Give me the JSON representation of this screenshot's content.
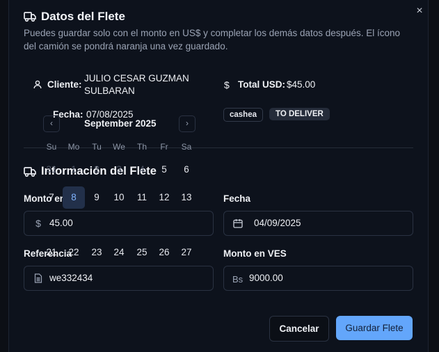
{
  "modal": {
    "title": "Datos del Flete",
    "description": "Puedes guardar solo con el monto en US$ y completar los demás datos después. El ícono del camión se pondrá naranja una vez guardado.",
    "close_icon": "×"
  },
  "summary": {
    "cliente_label": "Cliente:",
    "cliente_line1": "JULIO CESAR GUZMAN",
    "cliente_line2": "SULBARAN",
    "total_label": "Total USD:",
    "total_value": "$45.00",
    "fecha_label": "Fecha:",
    "fecha_value": "07/08/2025",
    "badges": [
      "cashea",
      "TO DELIVER"
    ]
  },
  "section2": {
    "title": "Información del Flete"
  },
  "form": {
    "monto_label": "Monto en",
    "monto_value": "45.00",
    "monto_icon": "$",
    "fecha_label": "Fecha",
    "fecha_value": "04/09/2025",
    "referencia_label": "Referencia",
    "referencia_value": "we332434",
    "ves_label": "Monto en VES",
    "ves_icon": "Bs",
    "ves_value": "9000.00"
  },
  "buttons": {
    "cancel": "Cancelar",
    "save": "Guardar Flete"
  },
  "calendar": {
    "month": "September 2025",
    "prev": "‹",
    "next": "›",
    "weekdays": [
      "Su",
      "Mo",
      "Tu",
      "We",
      "Th",
      "Fr",
      "Sa"
    ],
    "row1": [
      "31",
      "1",
      "2",
      "3",
      "4",
      "5",
      "6"
    ],
    "row2": [
      "7",
      "8",
      "9",
      "10",
      "11",
      "12",
      "13"
    ],
    "row4": [
      "21",
      "22",
      "23",
      "24",
      "25",
      "26",
      "27"
    ],
    "selected": "8"
  }
}
